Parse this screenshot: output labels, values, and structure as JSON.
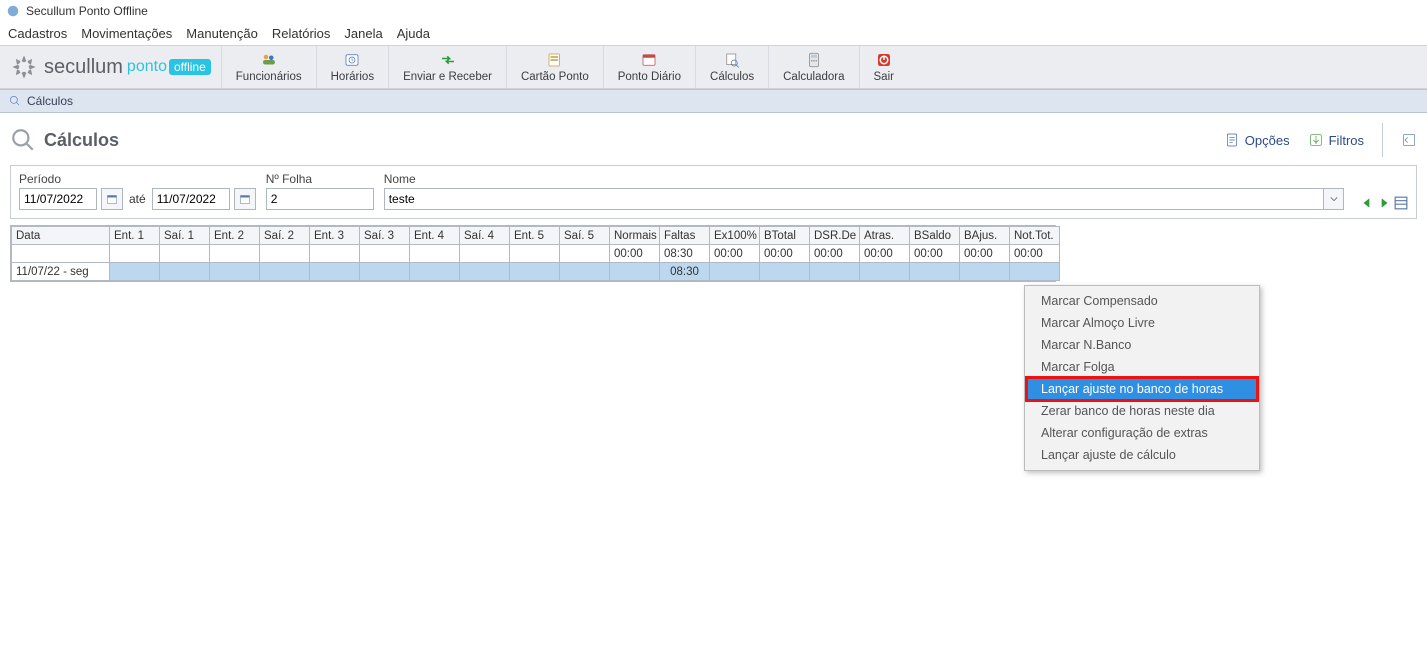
{
  "window_title": "Secullum Ponto Offline",
  "menubar": [
    "Cadastros",
    "Movimentações",
    "Manutenção",
    "Relatórios",
    "Janela",
    "Ajuda"
  ],
  "brand": {
    "name": "secullum",
    "sub1": "ponto",
    "sub2": "offline"
  },
  "toolbar": [
    {
      "id": "funcionarios",
      "label": "Funcionários"
    },
    {
      "id": "horarios",
      "label": "Horários"
    },
    {
      "id": "enviar-receber",
      "label": "Enviar e Receber"
    },
    {
      "id": "cartao-ponto",
      "label": "Cartão Ponto"
    },
    {
      "id": "ponto-diario",
      "label": "Ponto Diário"
    },
    {
      "id": "calculos",
      "label": "Cálculos"
    },
    {
      "id": "calculadora",
      "label": "Calculadora"
    },
    {
      "id": "sair",
      "label": "Sair"
    }
  ],
  "subheader": "Cálculos",
  "page_title": "Cálculos",
  "actions": {
    "opcoes": "Opções",
    "filtros": "Filtros"
  },
  "filters": {
    "periodo_label": "Período",
    "date_from": "11/07/2022",
    "ate": "até",
    "date_to": "11/07/2022",
    "nfolha_label": "Nº Folha",
    "nfolha": "2",
    "nome_label": "Nome",
    "nome": "teste"
  },
  "grid": {
    "headers": [
      "Data",
      "Ent. 1",
      "Saí. 1",
      "Ent. 2",
      "Saí. 2",
      "Ent. 3",
      "Saí. 3",
      "Ent. 4",
      "Saí. 4",
      "Ent. 5",
      "Saí. 5",
      "Normais",
      "Faltas",
      "Ex100%",
      "BTotal",
      "DSR.De",
      "Atras.",
      "BSaldo",
      "BAjus.",
      "Not.Tot."
    ],
    "totals": [
      "",
      "",
      "",
      "",
      "",
      "",
      "",
      "",
      "",
      "",
      "",
      "00:00",
      "08:30",
      "00:00",
      "00:00",
      "00:00",
      "00:00",
      "00:00",
      "00:00",
      "00:00"
    ],
    "row": {
      "data": "11/07/22 - seg",
      "faltas": "08:30"
    }
  },
  "context_menu": [
    "Marcar Compensado",
    "Marcar Almoço Livre",
    "Marcar N.Banco",
    "Marcar Folga",
    "Lançar ajuste no banco de horas",
    "Zerar banco de horas neste dia",
    "Alterar configuração de extras",
    "Lançar ajuste de cálculo"
  ],
  "context_menu_highlight_index": 4
}
